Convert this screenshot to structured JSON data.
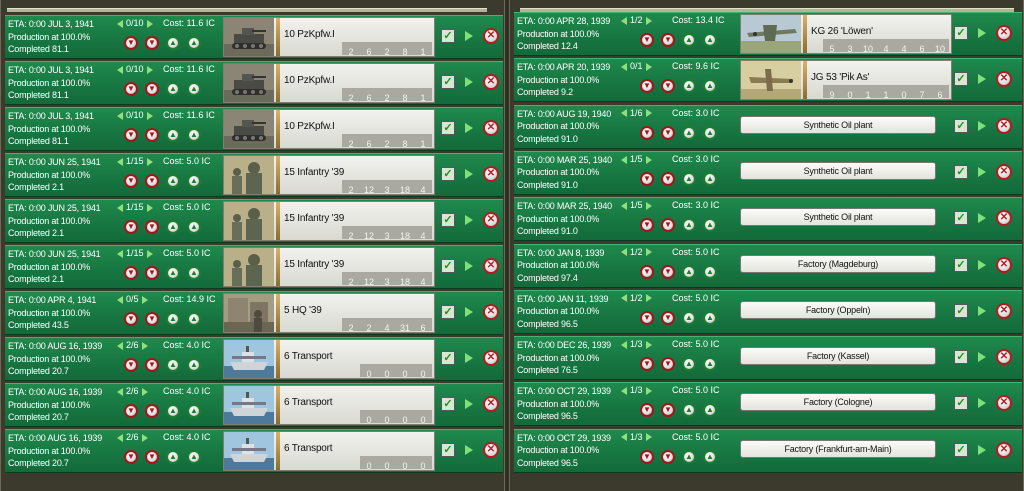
{
  "left_rows": [
    {
      "eta": "ETA: 0:00 JUL 3, 1941",
      "production": "Production at 100.0%",
      "completed": "Completed 81.1",
      "quantity": "0/10",
      "cost": "Cost: 11.6 IC",
      "unit": {
        "name": "10 PzKpfw.I",
        "stats": [
          "2",
          "6",
          "2",
          "8",
          "1"
        ],
        "portrait": "tank"
      }
    },
    {
      "eta": "ETA: 0:00 JUL 3, 1941",
      "production": "Production at 100.0%",
      "completed": "Completed 81.1",
      "quantity": "0/10",
      "cost": "Cost: 11.6 IC",
      "unit": {
        "name": "10 PzKpfw.I",
        "stats": [
          "2",
          "6",
          "2",
          "8",
          "1"
        ],
        "portrait": "tank"
      }
    },
    {
      "eta": "ETA: 0:00 JUL 3, 1941",
      "production": "Production at 100.0%",
      "completed": "Completed 81.1",
      "quantity": "0/10",
      "cost": "Cost: 11.6 IC",
      "unit": {
        "name": "10 PzKpfw.I",
        "stats": [
          "2",
          "6",
          "2",
          "8",
          "1"
        ],
        "portrait": "tank"
      }
    },
    {
      "eta": "ETA: 0:00 JUN 25, 1941",
      "production": "Production at 100.0%",
      "completed": "Completed 2.1",
      "quantity": "1/15",
      "cost": "Cost: 5.0 IC",
      "unit": {
        "name": "15 Infantry '39",
        "stats": [
          "2",
          "12",
          "3",
          "18",
          "4"
        ],
        "portrait": "infantry"
      }
    },
    {
      "eta": "ETA: 0:00 JUN 25, 1941",
      "production": "Production at 100.0%",
      "completed": "Completed 2.1",
      "quantity": "1/15",
      "cost": "Cost: 5.0 IC",
      "unit": {
        "name": "15 Infantry '39",
        "stats": [
          "2",
          "12",
          "3",
          "18",
          "4"
        ],
        "portrait": "infantry"
      }
    },
    {
      "eta": "ETA: 0:00 JUN 25, 1941",
      "production": "Production at 100.0%",
      "completed": "Completed 2.1",
      "quantity": "1/15",
      "cost": "Cost: 5.0 IC",
      "unit": {
        "name": "15 Infantry '39",
        "stats": [
          "2",
          "12",
          "3",
          "18",
          "4"
        ],
        "portrait": "infantry"
      }
    },
    {
      "eta": "ETA: 0:00 APR 4, 1941",
      "production": "Production at 100.0%",
      "completed": "Completed 43.5",
      "quantity": "0/5",
      "cost": "Cost: 14.9 IC",
      "unit": {
        "name": "5 HQ '39",
        "stats": [
          "2",
          "2",
          "4",
          "31",
          "6"
        ],
        "portrait": "hq"
      }
    },
    {
      "eta": "ETA: 0:00 AUG 16, 1939",
      "production": "Production at 100.0%",
      "completed": "Completed 20.7",
      "quantity": "2/6",
      "cost": "Cost: 4.0 IC",
      "unit": {
        "name": "6 Transport",
        "stats": [
          "0",
          "0",
          "0",
          "0"
        ],
        "portrait": "ship"
      }
    },
    {
      "eta": "ETA: 0:00 AUG 16, 1939",
      "production": "Production at 100.0%",
      "completed": "Completed 20.7",
      "quantity": "2/6",
      "cost": "Cost: 4.0 IC",
      "unit": {
        "name": "6 Transport",
        "stats": [
          "0",
          "0",
          "0",
          "0"
        ],
        "portrait": "ship"
      }
    },
    {
      "eta": "ETA: 0:00 AUG 16, 1939",
      "production": "Production at 100.0%",
      "completed": "Completed 20.7",
      "quantity": "2/6",
      "cost": "Cost: 4.0 IC",
      "unit": {
        "name": "6 Transport",
        "stats": [
          "0",
          "0",
          "0",
          "0"
        ],
        "portrait": "ship"
      }
    }
  ],
  "right_rows": [
    {
      "eta": "ETA: 0:00 APR 28, 1939",
      "production": "Production at 100.0%",
      "completed": "Completed 12.4",
      "quantity": "1/2",
      "cost": "Cost: 13.4 IC",
      "unit": {
        "name": "KG 26 'Löwen'",
        "stats": [
          "5",
          "3",
          "10",
          "4",
          "4",
          "6",
          "10"
        ],
        "portrait": "bomber"
      }
    },
    {
      "eta": "ETA: 0:00 APR 20, 1939",
      "production": "Production at 100.0%",
      "completed": "Completed 9.2",
      "quantity": "0/1",
      "cost": "Cost: 9.6 IC",
      "unit": {
        "name": "JG 53 'Pik As'",
        "stats": [
          "9",
          "0",
          "1",
          "1",
          "0",
          "7",
          "6"
        ],
        "portrait": "fighter"
      }
    },
    {
      "eta": "ETA: 0:00 AUG 19, 1940",
      "production": "Production at 100.0%",
      "completed": "Completed 91.0",
      "quantity": "1/6",
      "cost": "Cost: 3.0 IC",
      "building": "Synthetic Oil plant"
    },
    {
      "eta": "ETA: 0:00 MAR 25, 1940",
      "production": "Production at 100.0%",
      "completed": "Completed 91.0",
      "quantity": "1/5",
      "cost": "Cost: 3.0 IC",
      "building": "Synthetic Oil plant"
    },
    {
      "eta": "ETA: 0:00 MAR 25, 1940",
      "production": "Production at 100.0%",
      "completed": "Completed 91.0",
      "quantity": "1/5",
      "cost": "Cost: 3.0 IC",
      "building": "Synthetic Oil plant"
    },
    {
      "eta": "ETA: 0:00 JAN 8, 1939",
      "production": "Production at 100.0%",
      "completed": "Completed 97.4",
      "quantity": "1/2",
      "cost": "Cost: 5.0 IC",
      "building": "Factory (Magdeburg)"
    },
    {
      "eta": "ETA: 0:00 JAN 11, 1939",
      "production": "Production at 100.0%",
      "completed": "Completed 96.5",
      "quantity": "1/2",
      "cost": "Cost: 5.0 IC",
      "building": "Factory (Oppeln)"
    },
    {
      "eta": "ETA: 0:00 DEC 26, 1939",
      "production": "Production at 100.0%",
      "completed": "Completed 76.5",
      "quantity": "1/3",
      "cost": "Cost: 5.0 IC",
      "building": "Factory (Kassel)"
    },
    {
      "eta": "ETA: 0:00 OCT 29, 1939",
      "production": "Production at 100.0%",
      "completed": "Completed 96.5",
      "quantity": "1/3",
      "cost": "Cost: 5.0 IC",
      "building": "Factory (Cologne)"
    },
    {
      "eta": "ETA: 0:00 OCT 29, 1939",
      "production": "Production at 100.0%",
      "completed": "Completed 96.5",
      "quantity": "1/3",
      "cost": "Cost: 5.0 IC",
      "building": "Factory (Frankfurt-am-Main)"
    }
  ],
  "icons": {
    "priority_down_max": "double-chevron-down-icon",
    "priority_down": "chevron-down-icon",
    "priority_up": "chevron-up-icon",
    "priority_up_max": "double-chevron-up-icon",
    "confirm": "checkbox-icon",
    "start": "play-icon",
    "remove": "delete-icon"
  },
  "colors": {
    "row_green": "#177541",
    "cancel_red": "#b21b20",
    "arrow_green": "#8fe07c"
  }
}
